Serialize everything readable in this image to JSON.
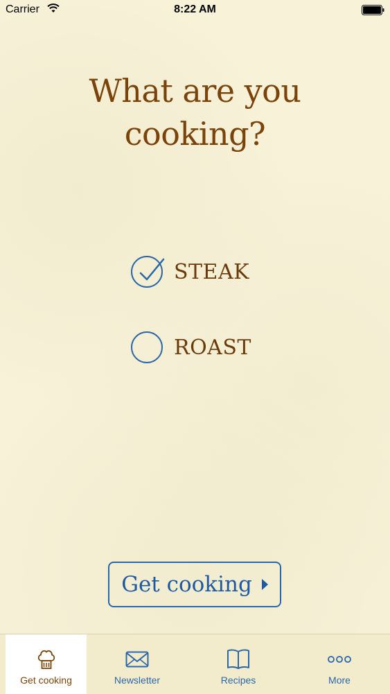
{
  "status_bar": {
    "carrier": "Carrier",
    "time": "8:22 AM"
  },
  "title_line1": "What are you",
  "title_line2": "cooking?",
  "options": [
    {
      "label": "STEAK",
      "selected": true
    },
    {
      "label": "ROAST",
      "selected": false
    }
  ],
  "cta": {
    "label": "Get cooking"
  },
  "tabs": [
    {
      "label": "Get cooking",
      "icon": "chef-hat-icon",
      "active": true
    },
    {
      "label": "Newsletter",
      "icon": "envelope-icon",
      "active": false
    },
    {
      "label": "Recipes",
      "icon": "book-icon",
      "active": false
    },
    {
      "label": "More",
      "icon": "more-dots-icon",
      "active": false
    }
  ],
  "colors": {
    "background": "#f7f2d8",
    "title": "#7a4309",
    "accent": "#2a66a8"
  }
}
